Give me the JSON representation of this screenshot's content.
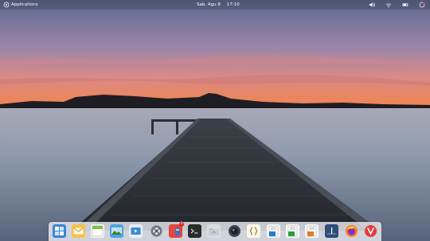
{
  "panel": {
    "applications_label": "Applications",
    "date": "Sab, Agu  8",
    "time": "17:10"
  },
  "dock": {
    "items": [
      {
        "name": "multitasking-view"
      },
      {
        "name": "mail"
      },
      {
        "name": "calendar"
      },
      {
        "name": "photos"
      },
      {
        "name": "videos"
      },
      {
        "name": "system-settings"
      },
      {
        "name": "appcenter",
        "badge": "3"
      },
      {
        "name": "terminal"
      },
      {
        "name": "files"
      },
      {
        "name": "screenshot"
      },
      {
        "name": "code"
      },
      {
        "name": "libreoffice-writer"
      },
      {
        "name": "libreoffice-calc"
      },
      {
        "name": "libreoffice-impress"
      },
      {
        "name": "sound-recorder"
      },
      {
        "name": "firefox"
      },
      {
        "name": "vivaldi"
      }
    ]
  },
  "colors": {
    "sky_top": "#5e6b91",
    "sky_mid": "#b48aa8",
    "horizon": "#f07a4a",
    "water": "#8b98a8",
    "dock_bg": "#ebebf0"
  }
}
